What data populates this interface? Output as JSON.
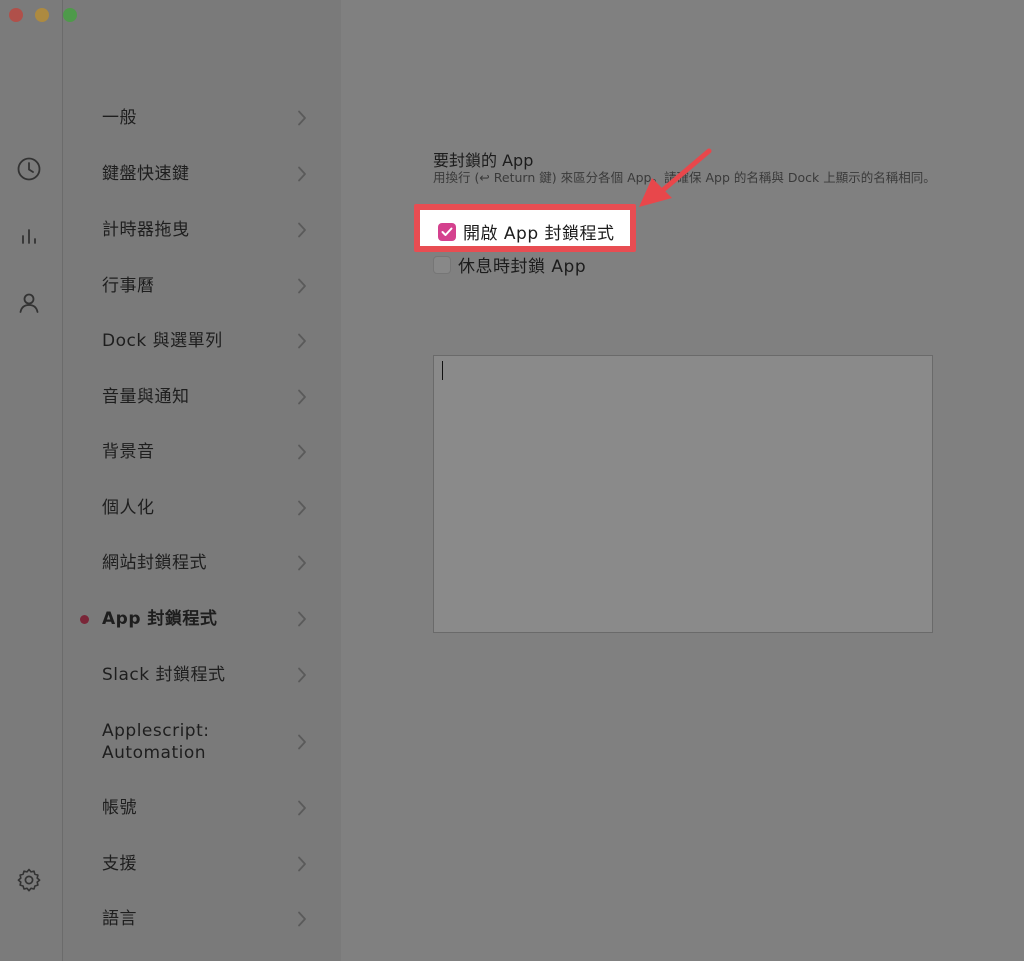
{
  "rail": {
    "icons": [
      "clock-icon",
      "chart-icon",
      "person-icon",
      "gear-icon"
    ]
  },
  "menu": {
    "items": [
      {
        "label": "一般",
        "active": false
      },
      {
        "label": "鍵盤快速鍵",
        "active": false
      },
      {
        "label": "計時器拖曳",
        "active": false
      },
      {
        "label": "行事曆",
        "active": false
      },
      {
        "label": "Dock 與選單列",
        "active": false
      },
      {
        "label": "音量與通知",
        "active": false
      },
      {
        "label": "背景音",
        "active": false
      },
      {
        "label": "個人化",
        "active": false
      },
      {
        "label": "網站封鎖程式",
        "active": false
      },
      {
        "label": "App 封鎖程式",
        "active": true
      },
      {
        "label": "Slack 封鎖程式",
        "active": false
      },
      {
        "label": "Applescript:\nAutomation",
        "active": false
      },
      {
        "label": "帳號",
        "active": false
      },
      {
        "label": "支援",
        "active": false
      },
      {
        "label": "語言",
        "active": false
      }
    ]
  },
  "main": {
    "section_title": "要封鎖的 App",
    "section_desc": "用換行 (↩ Return 鍵) 來區分各個 App。請確保 App 的名稱與 Dock 上顯示的名稱相同。",
    "enable_label": "開啟 App 封鎖程式",
    "enable_checked": true,
    "break_label": "休息時封鎖 App",
    "break_checked": false,
    "apps_value": ""
  },
  "colors": {
    "accent": "#d4418e",
    "highlight": "#e84d52",
    "active_dot": "#7a2638"
  }
}
